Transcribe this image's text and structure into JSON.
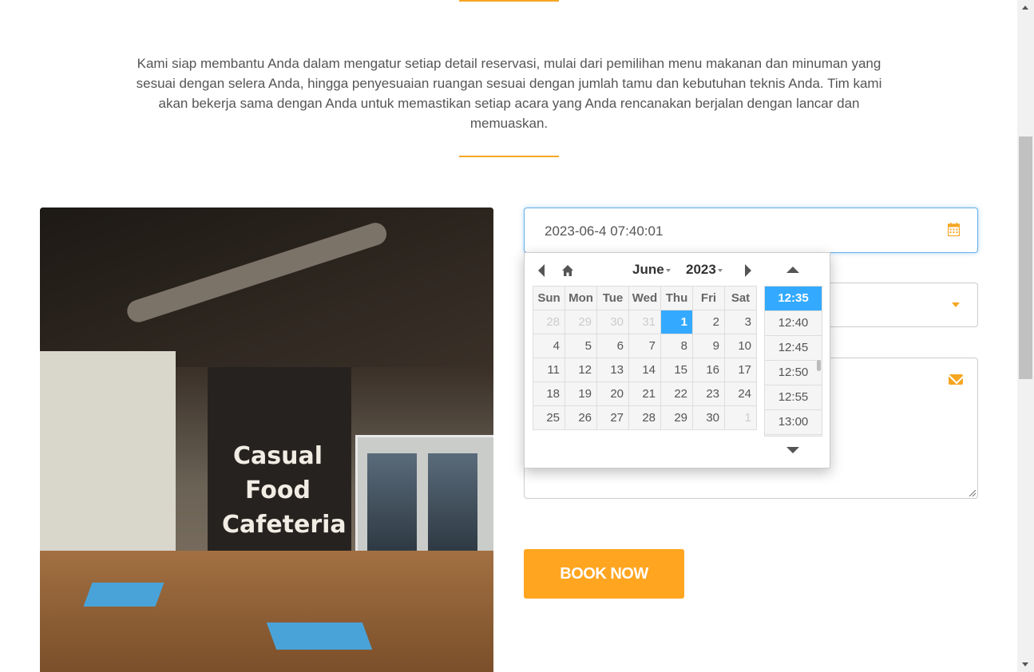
{
  "intro": {
    "text": "Kami siap membantu Anda dalam mengatur setiap detail reservasi, mulai dari pemilihan menu makanan dan minuman yang sesuai dengan selera Anda, hingga penyesuaian ruangan sesuai dengan jumlah tamu dan kebutuhan teknis Anda. Tim kami akan bekerja sama dengan Anda untuk memastikan setiap acara yang Anda rencanakan berjalan dengan lancar dan memuaskan."
  },
  "photo": {
    "sign_lines": [
      "Casual",
      "Food",
      "Cafeteria"
    ]
  },
  "form": {
    "datetime_value": "2023-06-4 07:40:01",
    "datetime_icon": "calendar-icon",
    "select_icon": "caret-down-icon",
    "message_icon": "envelope-icon",
    "book_label": "BOOK NOW"
  },
  "datepicker": {
    "month": "June",
    "year": "2023",
    "weekdays": [
      "Sun",
      "Mon",
      "Tue",
      "Wed",
      "Thu",
      "Fri",
      "Sat"
    ],
    "weeks": [
      [
        "28",
        "29",
        "30",
        "31",
        "1",
        "2",
        "3"
      ],
      [
        "4",
        "5",
        "6",
        "7",
        "8",
        "9",
        "10"
      ],
      [
        "11",
        "12",
        "13",
        "14",
        "15",
        "16",
        "17"
      ],
      [
        "18",
        "19",
        "20",
        "21",
        "22",
        "23",
        "24"
      ],
      [
        "25",
        "26",
        "27",
        "28",
        "29",
        "30",
        "1"
      ]
    ],
    "times": [
      "12:35",
      "12:40",
      "12:45",
      "12:50",
      "12:55",
      "13:00"
    ],
    "selected_time": "12:35",
    "today_day": "1",
    "accent_color": "#33aaff"
  },
  "colors": {
    "brand_orange": "#ffa520",
    "rule_orange": "#f5a623"
  }
}
